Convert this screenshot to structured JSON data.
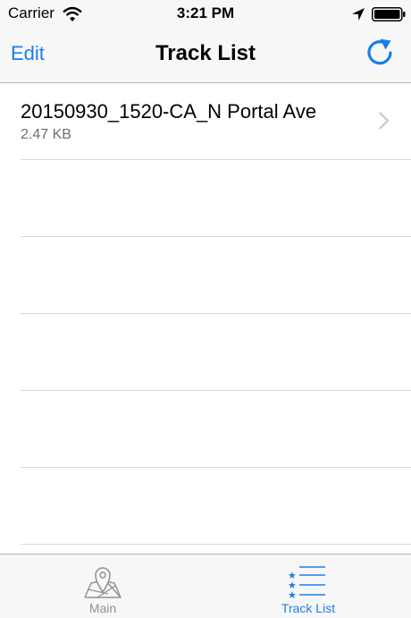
{
  "status_bar": {
    "carrier": "Carrier",
    "time": "3:21 PM",
    "icons": [
      "wifi-icon",
      "location-arrow-icon",
      "battery-icon"
    ]
  },
  "nav_bar": {
    "edit_label": "Edit",
    "title": "Track List",
    "refresh_icon": "refresh-icon"
  },
  "tracks": [
    {
      "name": "20150930_1520-CA_N Portal Ave",
      "size": "2.47  KB"
    }
  ],
  "tab_bar": {
    "tabs": [
      {
        "label": "Main",
        "icon": "map-pin-icon",
        "selected": false
      },
      {
        "label": "Track List",
        "icon": "list-icon",
        "selected": true
      }
    ]
  },
  "colors": {
    "accent": "#1a7ee8",
    "bar_background": "#f7f7f7",
    "inactive_tab": "#929292",
    "separator": "#d8d8d8"
  }
}
